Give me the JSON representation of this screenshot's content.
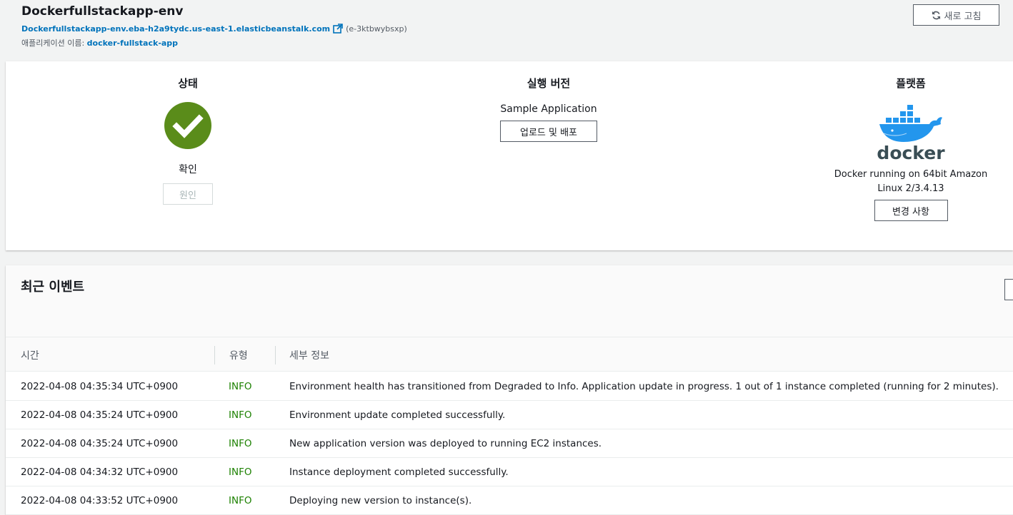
{
  "header": {
    "title": "Dockerfullstackapp-env",
    "url": "Dockerfullstackapp-env.eba-h2a9tydc.us-east-1.elasticbeanstalk.com",
    "env_id": "(e-3ktbwybsxp)",
    "app_label": "애플리케이션 이름:",
    "app_name": "docker-fullstack-app",
    "refresh_label": "새로 고침"
  },
  "overview": {
    "status": {
      "title": "상태",
      "value": "확인",
      "cause_label": "원인",
      "icon": "check-circle-icon",
      "color": "#5a8c1a"
    },
    "version": {
      "title": "실행 버전",
      "value": "Sample Application",
      "upload_label": "업로드 및 배포"
    },
    "platform": {
      "title": "플랫폼",
      "logo_text": "docker",
      "desc_line1": "Docker running on 64bit Amazon",
      "desc_line2": "Linux 2/3.4.13",
      "change_label": "변경 사항"
    }
  },
  "events": {
    "title": "최근 이벤트",
    "columns": [
      "시간",
      "유형",
      "세부 정보"
    ],
    "rows": [
      {
        "time": "2022-04-08 04:35:34 UTC+0900",
        "type": "INFO",
        "detail": "Environment health has transitioned from Degraded to Info. Application update in progress. 1 out of 1 instance completed (running for 2 minutes)."
      },
      {
        "time": "2022-04-08 04:35:24 UTC+0900",
        "type": "INFO",
        "detail": "Environment update completed successfully."
      },
      {
        "time": "2022-04-08 04:35:24 UTC+0900",
        "type": "INFO",
        "detail": "New application version was deployed to running EC2 instances."
      },
      {
        "time": "2022-04-08 04:34:32 UTC+0900",
        "type": "INFO",
        "detail": "Instance deployment completed successfully."
      },
      {
        "time": "2022-04-08 04:33:52 UTC+0900",
        "type": "INFO",
        "detail": "Deploying new version to instance(s)."
      }
    ]
  },
  "colors": {
    "link": "#0073bb",
    "info": "#1d8102",
    "docker_blue": "#2396ed",
    "docker_text": "#394d54"
  }
}
